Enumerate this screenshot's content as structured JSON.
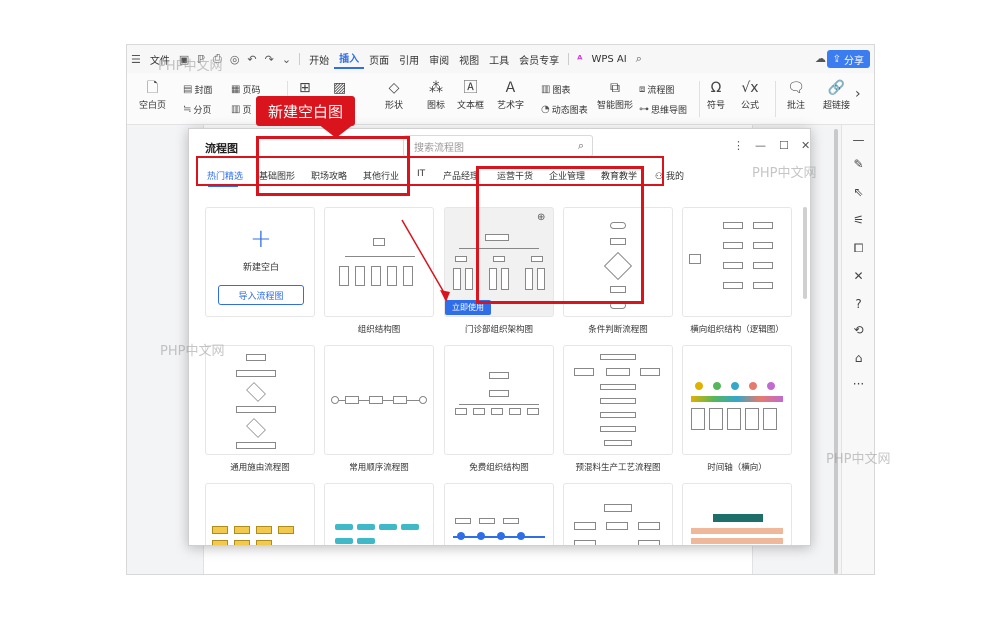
{
  "menubar": {
    "file": "文件",
    "tabs": [
      "开始",
      "插入",
      "页面",
      "引用",
      "审阅",
      "视图",
      "工具",
      "会员专享"
    ],
    "active_tab": "插入",
    "wps_ai": "WPS AI",
    "share": "分享"
  },
  "ribbon": {
    "blank_page": "空白页",
    "cover": "封面",
    "section": "分页",
    "page_num": "页码",
    "page_short": "页",
    "shape": "形状",
    "icon": "图标",
    "textbox": "文本框",
    "art_text": "艺术字",
    "chart": "图表",
    "dynamic_chart": "动态图表",
    "smart_graphic": "智能图形",
    "flowchart": "流程图",
    "mindmap": "思维导图",
    "symbol": "符号",
    "formula": "公式",
    "comment": "批注",
    "hyperlink": "超链接"
  },
  "dialog": {
    "title": "流程图",
    "search_placeholder": "搜索流程图",
    "tabs": [
      "热门精选",
      "基础图形",
      "职场攻略",
      "其他行业",
      "IT",
      "产品经理",
      "运营干货",
      "企业管理",
      "教育教学",
      "我的"
    ],
    "selected_tab": "热门精选",
    "new_blank": "新建空白",
    "import": "导入流程图",
    "use_now": "立即使用",
    "templates": [
      "组织结构图",
      "门诊部组织架构图",
      "条件判断流程图",
      "横向组织结构（逻辑图）",
      "通用施由流程图",
      "常用顺序流程图",
      "免费组织结构图",
      "预混料生产工艺流程图",
      "时间轴（横向）"
    ]
  },
  "annotation": {
    "callout": "新建空白图"
  },
  "watermark": "PHP中文网",
  "colors": {
    "accent": "#2f6ee8",
    "annotation_red": "#d9141d"
  }
}
